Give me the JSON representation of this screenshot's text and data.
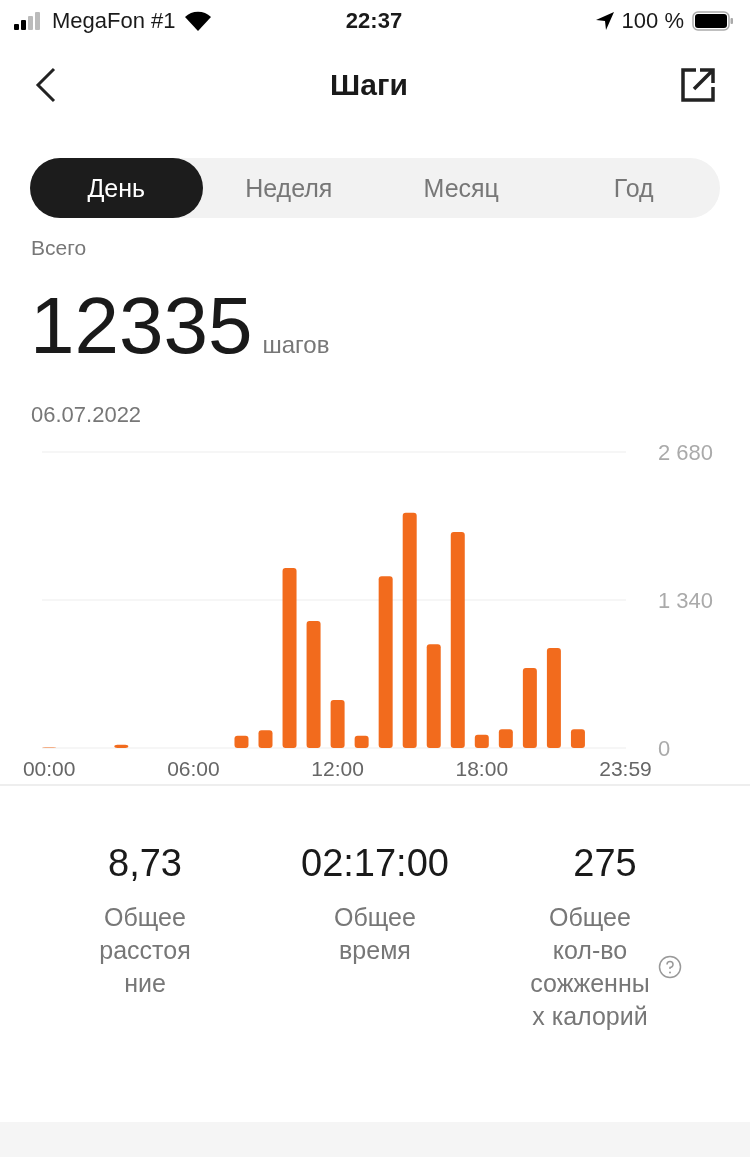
{
  "status_bar": {
    "carrier": "MegaFon #1",
    "time": "22:37",
    "battery": "100 %"
  },
  "header": {
    "title": "Шаги"
  },
  "tabs": [
    {
      "label": "День",
      "selected": true
    },
    {
      "label": "Неделя",
      "selected": false
    },
    {
      "label": "Месяц",
      "selected": false
    },
    {
      "label": "Год",
      "selected": false
    }
  ],
  "summary": {
    "label": "Всего",
    "value": "12335",
    "unit": "шагов",
    "date": "06.07.2022"
  },
  "chart": {
    "chart_data": {
      "type": "bar",
      "x": [
        0,
        3,
        8,
        9,
        10,
        11,
        12,
        13,
        14,
        15,
        16,
        17,
        18,
        19,
        20,
        21,
        22
      ],
      "series": [
        {
          "color": "#f26b1d",
          "values": [
            5,
            30,
            110,
            160,
            1630,
            1150,
            435,
            110,
            1555,
            2130,
            940,
            1955,
            120,
            170,
            725,
            905,
            170
          ]
        }
      ],
      "xlim": [
        -0.3,
        24
      ],
      "ylim": [
        0,
        2680
      ],
      "yticks": [
        {
          "value": 0,
          "label": "0"
        },
        {
          "value": 1340,
          "label": "1 340"
        },
        {
          "value": 2680,
          "label": "2 680"
        }
      ],
      "xticks": [
        {
          "value": 0,
          "label": "00:00"
        },
        {
          "value": 6,
          "label": "06:00"
        },
        {
          "value": 12,
          "label": "12:00"
        },
        {
          "value": 18,
          "label": "18:00"
        },
        {
          "value": 23.98,
          "label": "23:59"
        }
      ]
    }
  },
  "stats": [
    {
      "value": "8,73",
      "label": "Общее расстоя ние",
      "help": false
    },
    {
      "value": "02:17:00",
      "label": "Общее время",
      "help": false
    },
    {
      "value": "275",
      "label": "Общее кол-во сожженны х калорий",
      "help": true
    }
  ]
}
